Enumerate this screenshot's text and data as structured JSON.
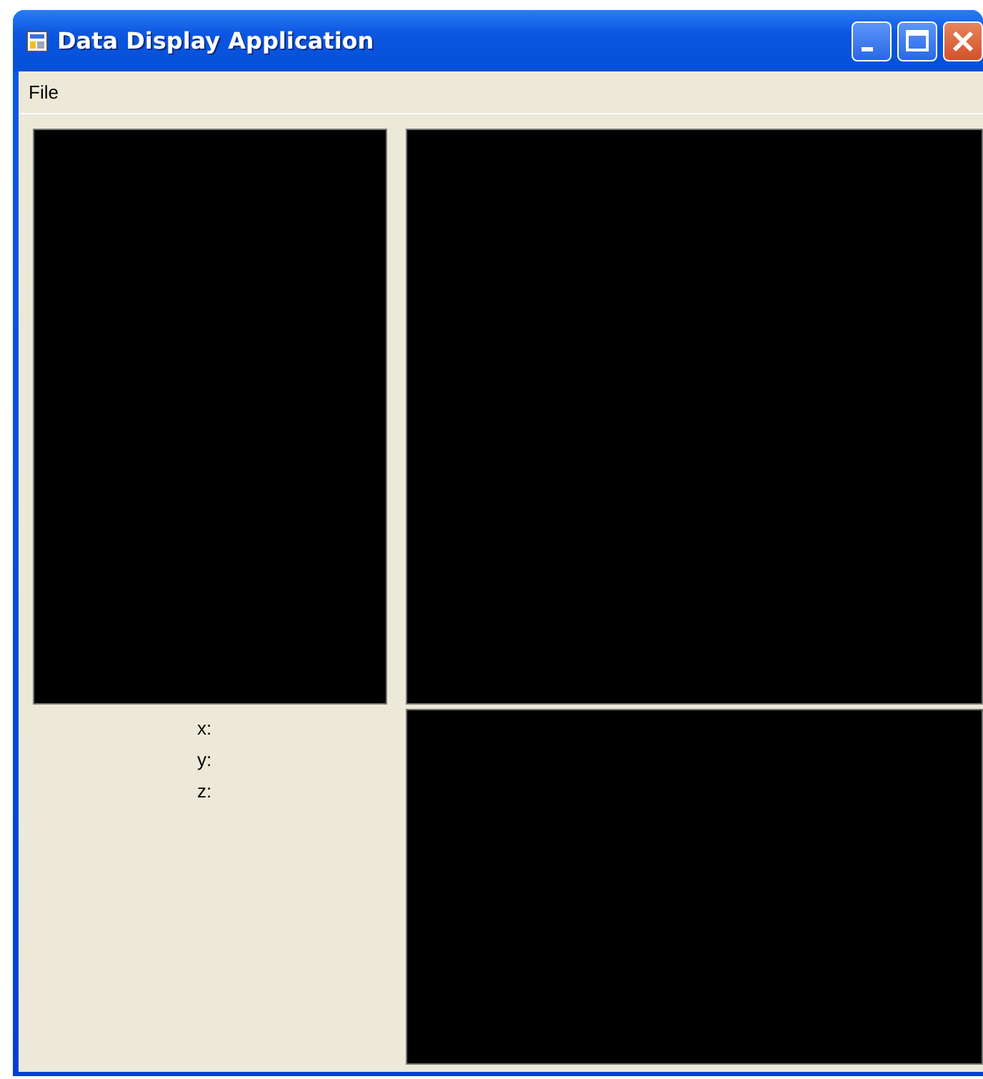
{
  "window": {
    "title": "Data Display Application"
  },
  "menu": [
    {
      "label": "File"
    }
  ],
  "coordinates": [
    {
      "label": "x:"
    },
    {
      "label": "y:"
    },
    {
      "label": "z:"
    }
  ]
}
